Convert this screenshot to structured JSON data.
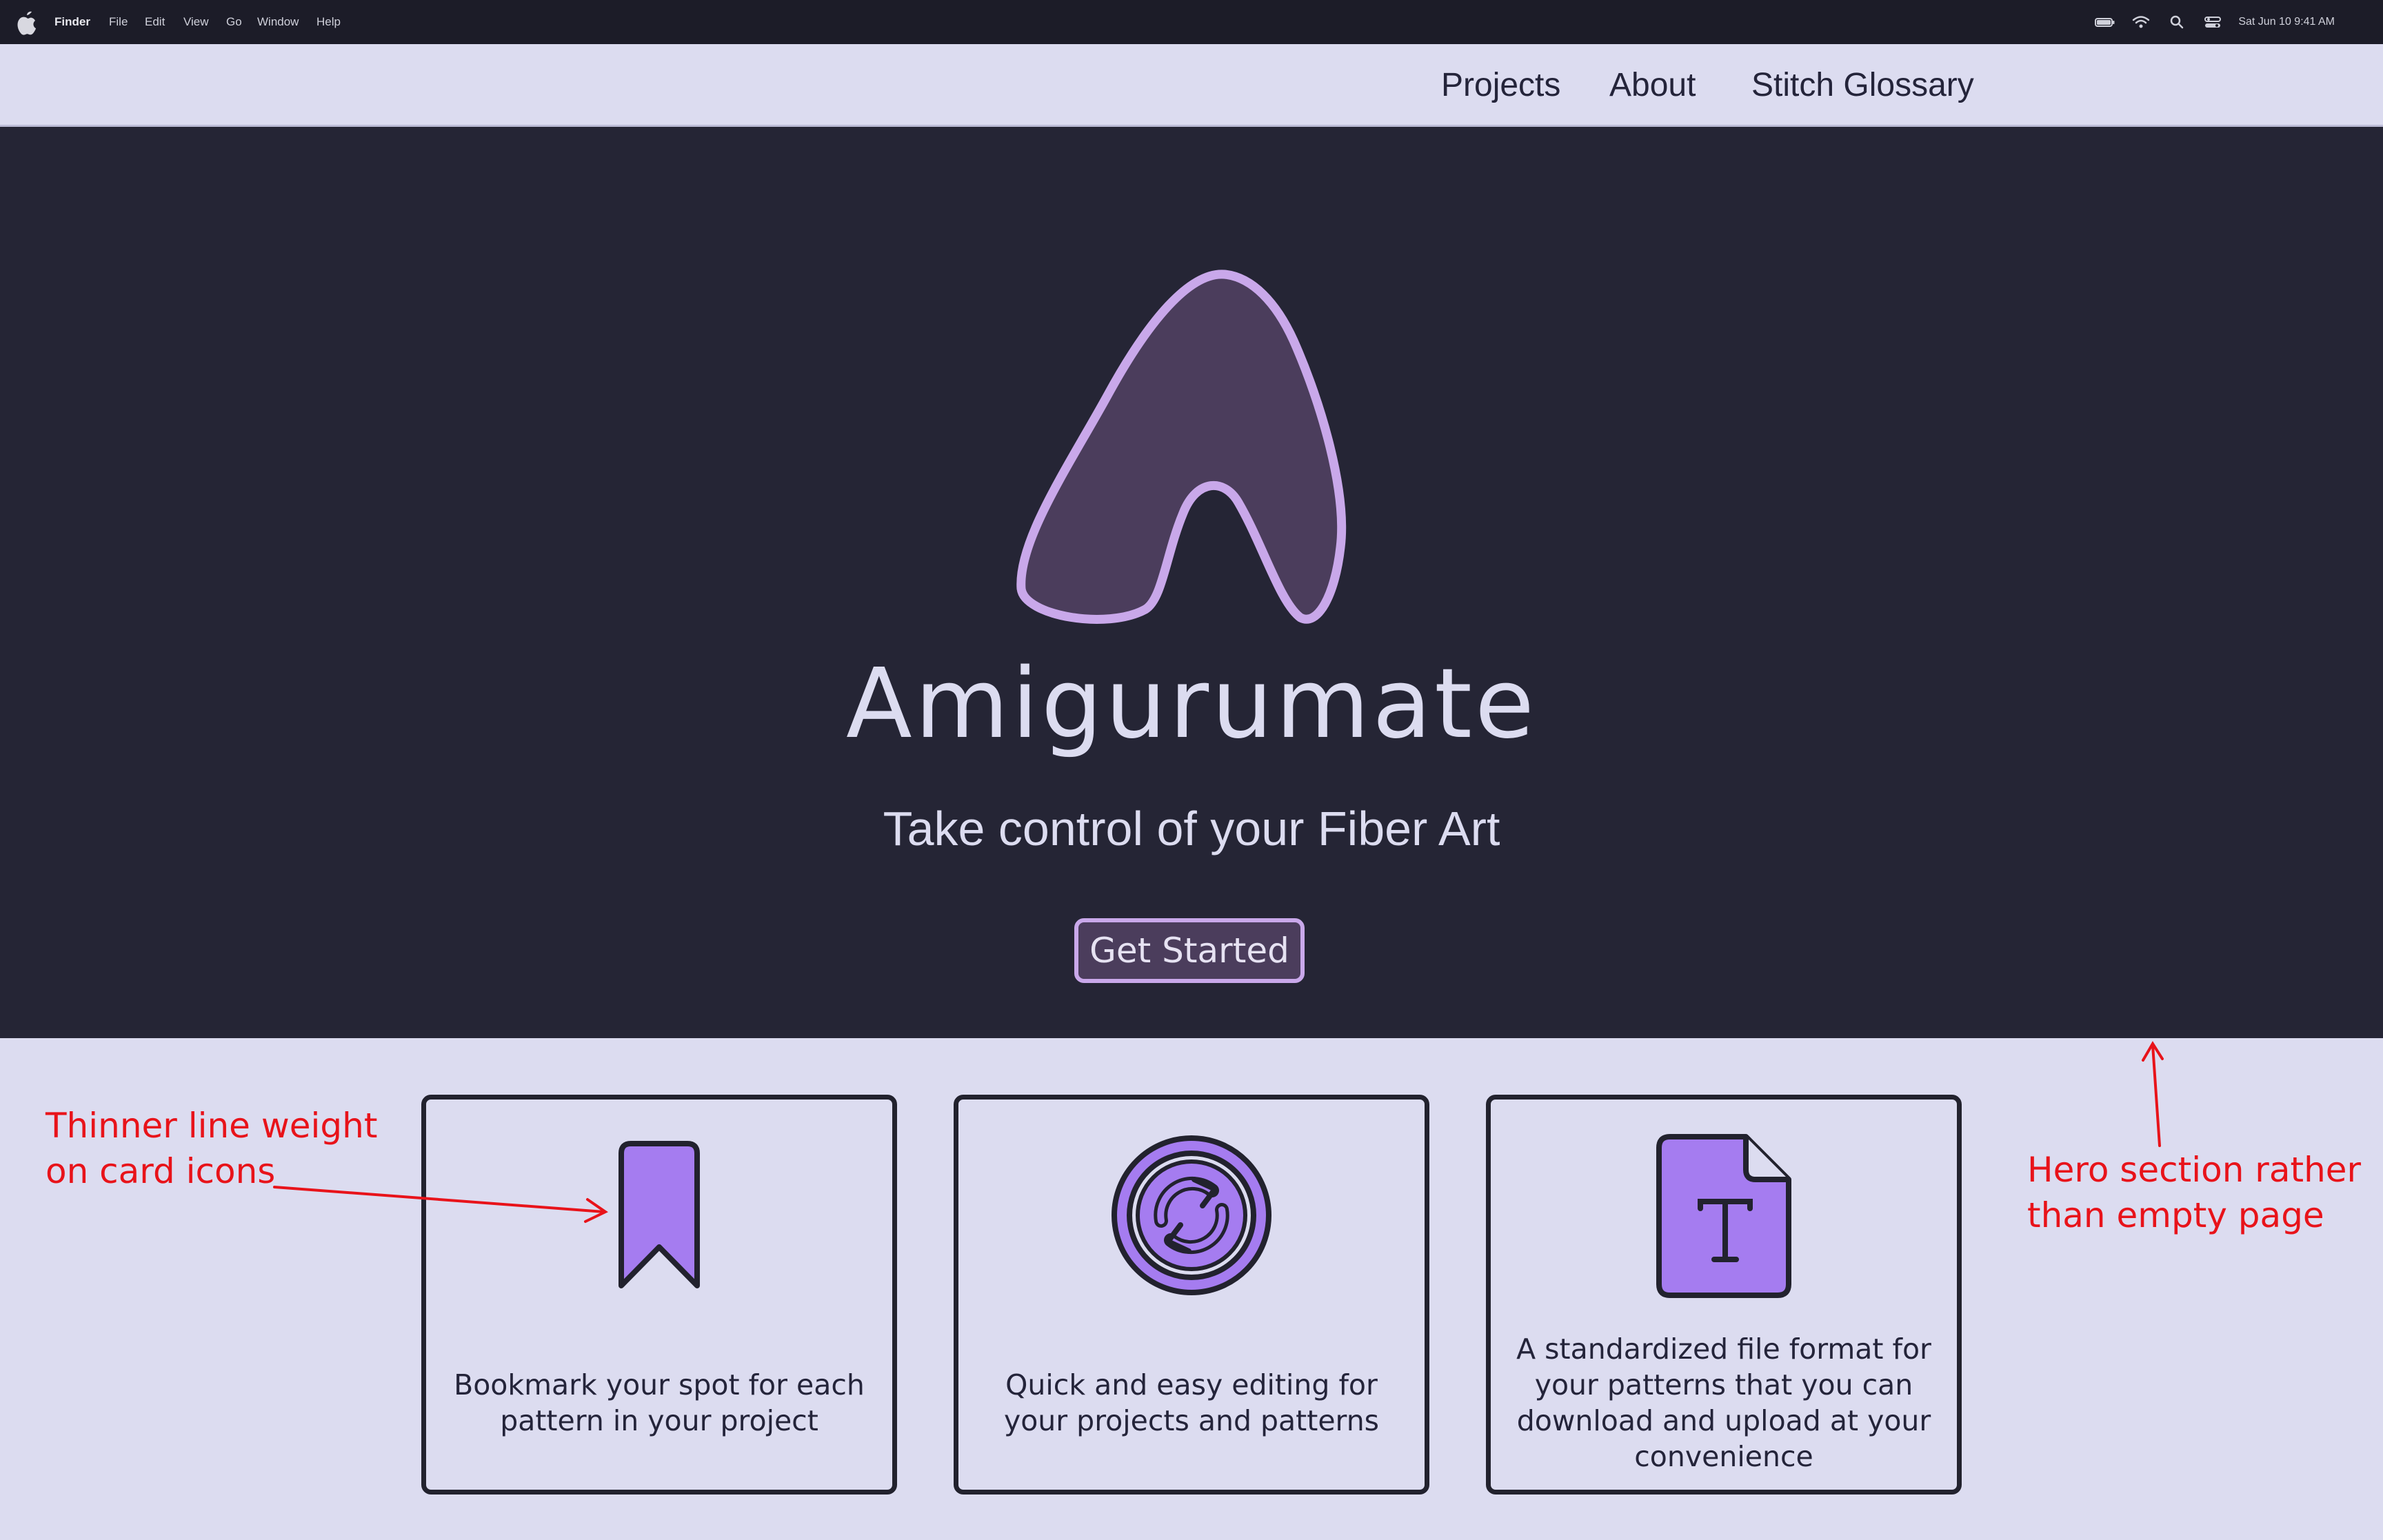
{
  "menubar": {
    "app_name": "Finder",
    "items": [
      "File",
      "Edit",
      "View",
      "Go",
      "Window",
      "Help"
    ],
    "clock": "Sat Jun 10  9:41 AM",
    "icons": [
      "apple-icon",
      "battery-icon",
      "wifi-icon",
      "search-icon",
      "control-center-icon"
    ]
  },
  "nav": {
    "links": [
      "Projects",
      "About",
      "Stitch Glossary"
    ]
  },
  "hero": {
    "brand": "Amigurumate",
    "tagline": "Take control of your Fiber Art",
    "cta_label": "Get Started",
    "logo_icon": "amigurumi-logo-icon"
  },
  "features": [
    {
      "icon": "bookmark-icon",
      "text": "Bookmark your spot for each pattern in your project"
    },
    {
      "icon": "sync-icon",
      "text": "Quick and easy editing for your projects and patterns"
    },
    {
      "icon": "text-file-icon",
      "text": "A standardized file format for your patterns that you can download and upload at your convenience"
    }
  ],
  "annotations": {
    "icons_note": "Thinner line weight\non card icons",
    "hero_note": "Hero section rather\nthan empty page"
  },
  "colors": {
    "hero_bg": "#252535",
    "page_bg": "#dcdcf0",
    "accent": "#c9a8ea",
    "icon_fill": "#a57cf0",
    "annotation": "#e8131a"
  }
}
